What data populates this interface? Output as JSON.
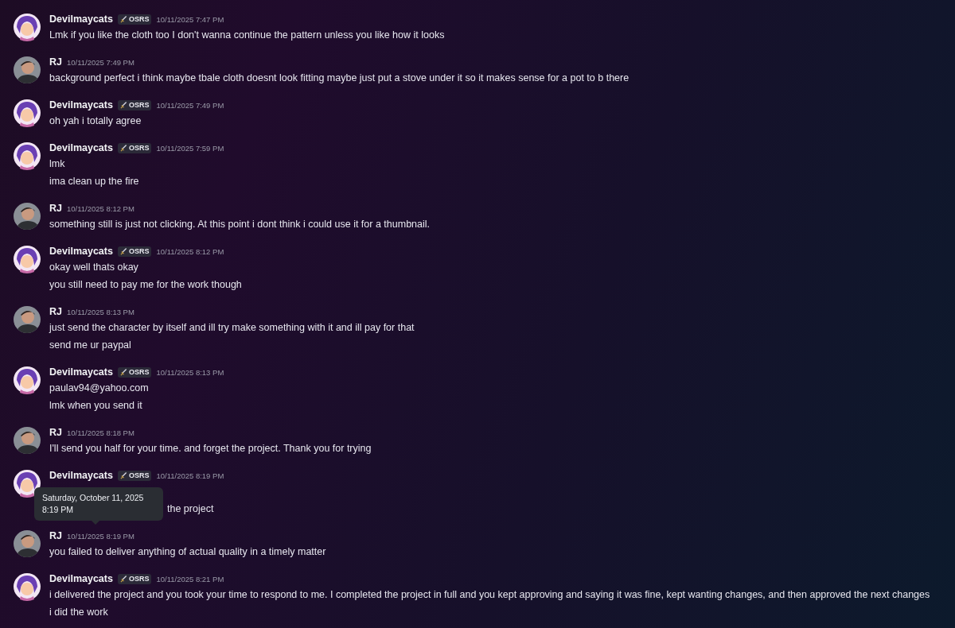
{
  "messages": [
    {
      "author": "Devilmaycats",
      "badge": "OSRS",
      "time": "10/11/2025 7:47 PM",
      "lines": [
        "Lmk if you like the cloth too I don't wanna continue the pattern unless you like how it looks"
      ]
    },
    {
      "author": "RJ",
      "time": "10/11/2025 7:49 PM",
      "lines": [
        "background perfect i think maybe tbale cloth doesnt look fitting maybe just put a stove under it so it makes sense for a pot to b there"
      ]
    },
    {
      "author": "Devilmaycats",
      "badge": "OSRS",
      "time": "10/11/2025 7:49 PM",
      "lines": [
        "oh yah i totally agree"
      ]
    },
    {
      "author": "Devilmaycats",
      "badge": "OSRS",
      "time": "10/11/2025 7:59 PM",
      "lines": [
        "lmk",
        "ima clean up the fire"
      ]
    },
    {
      "author": "RJ",
      "time": "10/11/2025 8:12 PM",
      "lines": [
        "something still is just not clicking. At this point i dont think i could use it for a thumbnail."
      ]
    },
    {
      "author": "Devilmaycats",
      "badge": "OSRS",
      "time": "10/11/2025 8:12 PM",
      "lines": [
        "okay well thats okay",
        "you still need to pay me for the work though"
      ]
    },
    {
      "author": "RJ",
      "time": "10/11/2025 8:13 PM",
      "lines": [
        "just send the character by itself and ill try make something with it and ill pay for that",
        "send me ur paypal"
      ]
    },
    {
      "author": "Devilmaycats",
      "badge": "OSRS",
      "time": "10/11/2025 8:13 PM",
      "lines": [
        "paulav94@yahoo.com",
        "lmk when you send it"
      ]
    },
    {
      "author": "RJ",
      "time": "10/11/2025 8:18 PM",
      "lines": [
        "I'll send you half for your time. and forget the project. Thank you for trying"
      ]
    },
    {
      "author": "Devilmaycats",
      "badge": "OSRS",
      "time": "10/11/2025 8:19 PM",
      "lines": [
        "the project"
      ],
      "tooltip": [
        "Saturday, October 11, 2025",
        "8:19 PM"
      ]
    },
    {
      "author": "RJ",
      "time": "10/11/2025 8:19 PM",
      "lines": [
        "you failed to deliver anything of actual quality in a timely matter"
      ]
    },
    {
      "author": "Devilmaycats",
      "badge": "OSRS",
      "time": "10/11/2025 8:21 PM",
      "lines": [
        "i delivered the project and you took your time to respond to me. I completed the project in full and you kept approving and saying it was fine, kept wanting changes, and then approved the next changes",
        "i did the work"
      ]
    }
  ]
}
